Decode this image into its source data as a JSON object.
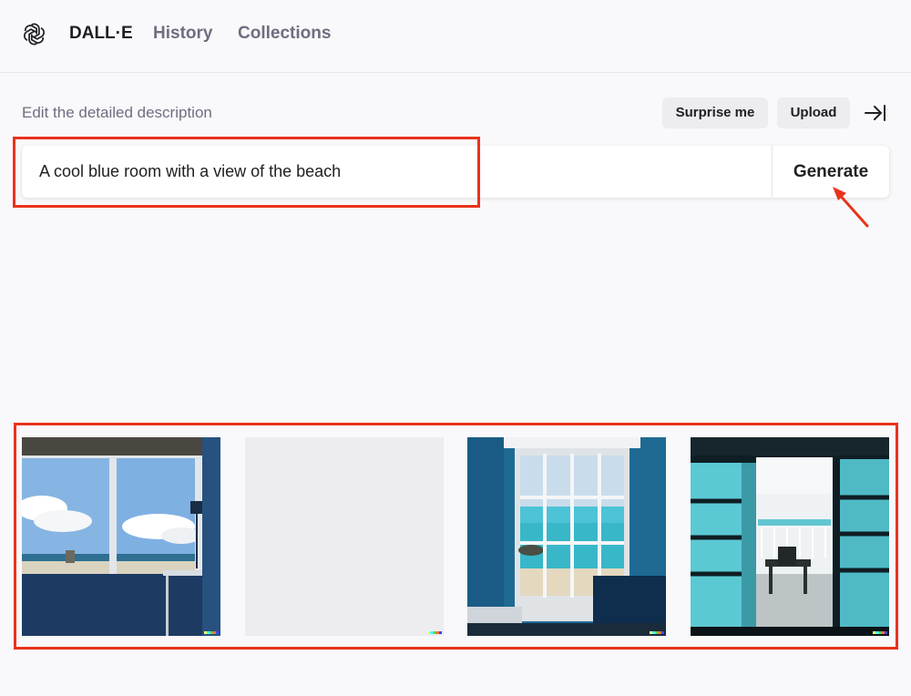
{
  "header": {
    "brand": "DALL·E",
    "nav": {
      "history": "History",
      "collections": "Collections"
    }
  },
  "editor": {
    "label": "Edit the detailed description",
    "surprise_label": "Surprise me",
    "upload_label": "Upload",
    "prompt_value": "A cool blue room with a view of the beach",
    "generate_label": "Generate"
  },
  "results": {
    "images": [
      {
        "alt": "blue room with window view of beach and clouds"
      },
      {
        "alt": "loading placeholder"
      },
      {
        "alt": "blue room with glass doors opening onto turquoise sea"
      },
      {
        "alt": "room with teal glass doors opening to balcony with chairs"
      }
    ]
  },
  "annotations": {
    "color": "#e8331c"
  }
}
